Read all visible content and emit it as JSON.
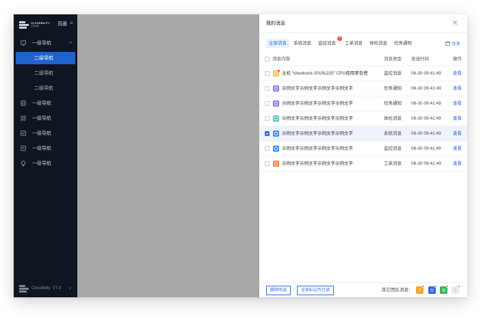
{
  "sidebar": {
    "brand": {
      "name": "CLOUDBILITY",
      "sub": "行云管家",
      "page_label": "页面"
    },
    "menu_icon": "menu-icon",
    "items": [
      {
        "label": "一级导航",
        "icon": "monitor-icon",
        "expanded": true,
        "children": [
          {
            "label": "二级导航",
            "active": true
          },
          {
            "label": "二级导航",
            "active": false
          },
          {
            "label": "二级导航",
            "active": false
          }
        ]
      },
      {
        "label": "一级导航",
        "icon": "database-icon"
      },
      {
        "label": "一级导航",
        "icon": "apps-icon"
      },
      {
        "label": "一级导航",
        "icon": "chart-icon"
      },
      {
        "label": "一级导航",
        "icon": "list-icon"
      },
      {
        "label": "一级导航",
        "icon": "globe-icon"
      }
    ],
    "footer": {
      "brand": "Cloudbility",
      "version": "V7.0"
    }
  },
  "drawer": {
    "title": "我的消息",
    "tabs": [
      {
        "label": "全部消息",
        "active": true
      },
      {
        "label": "系统消息",
        "active": false
      },
      {
        "label": "监控消息",
        "active": false,
        "badge": "1"
      },
      {
        "label": "工单消息",
        "active": false
      },
      {
        "label": "体检消息",
        "active": false
      },
      {
        "label": "任务通知",
        "active": false
      }
    ],
    "today_label": "今天",
    "table": {
      "headers": {
        "content": "消息内容",
        "type": "消息类型",
        "time": "发送时间",
        "op": "操作"
      },
      "rows": [
        {
          "content": "主机 “cloudcost-20191225” CPU使用率告警",
          "type": "监控消息",
          "time": "06-30  09:41:49",
          "op": "查看",
          "icon_color": "#f5b942",
          "icon": "alert-icon",
          "unread": true,
          "checked": false
        },
        {
          "content": "示例文字示例文字示例文字示例文字",
          "type": "任务通知",
          "time": "06-30  09:41:49",
          "op": "查看",
          "icon_color": "#7a6ee8",
          "icon": "doc-icon",
          "unread": false,
          "checked": false
        },
        {
          "content": "示例文字示例文字示例文字示例文字",
          "type": "任务通知",
          "time": "06-30  09:41:49",
          "op": "查看",
          "icon_color": "#7a6ee8",
          "icon": "doc-icon",
          "unread": false,
          "checked": false
        },
        {
          "content": "示例文字示例文字示例文字示例文字",
          "type": "体检消息",
          "time": "06-30  09:41:49",
          "op": "查看",
          "icon_color": "#4cc4b4",
          "icon": "screen-icon",
          "unread": false,
          "checked": false
        },
        {
          "content": "示例文字示例文字示例文字示例文字",
          "type": "系统消息",
          "time": "06-30  09:41:49",
          "op": "查看",
          "icon_color": "#3d8ef0",
          "icon": "bell-icon",
          "unread": false,
          "checked": true
        },
        {
          "content": "示例文字示例文字示例文字示例文字",
          "type": "监控消息",
          "time": "06-30  09:41:49",
          "op": "查看",
          "icon_color": "#3d8ef0",
          "icon": "bell-icon",
          "unread": false,
          "checked": false
        },
        {
          "content": "示例文字示例文字示例文字示例文字",
          "type": "工单消息",
          "time": "06-30  09:41:49",
          "op": "查看",
          "icon_color": "#f0763a",
          "icon": "ticket-icon",
          "unread": false,
          "checked": false
        }
      ]
    },
    "footer": {
      "delete_selected": "删除所选",
      "mark_all_read": "全部标记为已读",
      "other_teams_label": "其它团队消息：",
      "teams": [
        {
          "initial": "Z",
          "color": "#f5a623"
        },
        {
          "initial": "行",
          "color": "#2f6bd9"
        },
        {
          "initial": "设",
          "color": "#34b356"
        },
        {
          "initial": "⋮",
          "color": "#e8eaee"
        }
      ]
    }
  },
  "colors": {
    "accent": "#2f6bd9",
    "sidebar_bg": "#0f1622",
    "active_nav": "#1f63cc",
    "badge": "#f04a4a",
    "backdrop": "#a8a8a8"
  }
}
